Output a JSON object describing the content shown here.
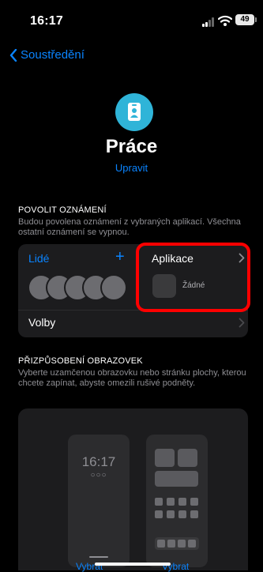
{
  "status_bar": {
    "time": "16:17",
    "battery": "49"
  },
  "nav": {
    "back_label": "Soustředění"
  },
  "focus": {
    "title": "Práce",
    "edit_label": "Upravit",
    "icon": "id-badge-icon",
    "accent": "#2fb4d8"
  },
  "notifications": {
    "title": "POVOLIT OZNÁMENÍ",
    "description": "Budou povolena oznámení z vybraných aplikací. Všechna ostatní oznámení se vypnou.",
    "people_label": "Lidé",
    "add_label": "+",
    "apps_label": "Aplikace",
    "apps_value": "Žádné",
    "options_label": "Volby"
  },
  "screens": {
    "title": "PŘIZPŮSOBENÍ OBRAZOVEK",
    "description": "Vyberte uzamčenou obrazovku nebo stránku plochy, kterou chcete zapínat, abyste omezili rušivé podněty.",
    "lock_time": "16:17",
    "lock_dots": "○○○",
    "choose_lock": "Vybrat",
    "choose_home": "Vybrat"
  },
  "colors": {
    "link": "#0a84ff",
    "highlight": "#ff0000",
    "card": "#1c1c1e"
  }
}
